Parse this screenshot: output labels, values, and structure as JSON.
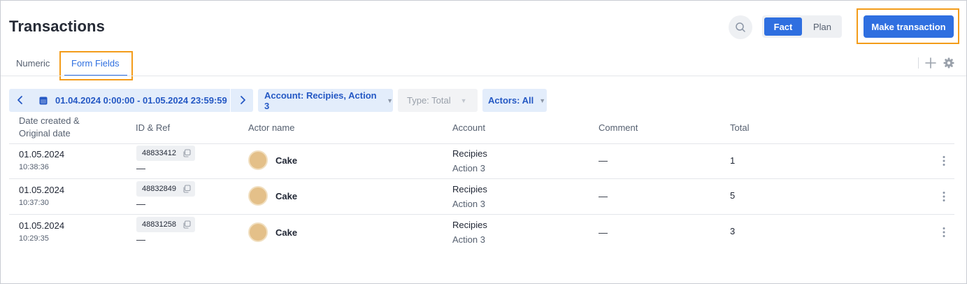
{
  "header": {
    "title": "Transactions",
    "toggle": {
      "fact": "Fact",
      "plan": "Plan"
    },
    "make_transaction": "Make transaction"
  },
  "tabs": [
    {
      "label": "Numeric",
      "active": false
    },
    {
      "label": "Form Fields",
      "active": true
    }
  ],
  "filters": {
    "date_range": "01.04.2024 0:00:00 - 01.05.2024 23:59:59",
    "account": "Account: Recipies, Action 3",
    "type": "Type: Total",
    "actors": "Actors: All"
  },
  "table": {
    "columns": {
      "date_line1": "Date created &",
      "date_line2": "Original date",
      "id_ref": "ID & Ref",
      "actor": "Actor name",
      "account": "Account",
      "comment": "Comment",
      "total": "Total"
    },
    "rows": [
      {
        "date": "01.05.2024",
        "time": "10:38:36",
        "id": "48833412",
        "ref": "—",
        "actor": "Cake",
        "account": "Recipies",
        "action": "Action 3",
        "comment": "—",
        "total": "1"
      },
      {
        "date": "01.05.2024",
        "time": "10:37:30",
        "id": "48832849",
        "ref": "—",
        "actor": "Cake",
        "account": "Recipies",
        "action": "Action 3",
        "comment": "—",
        "total": "5"
      },
      {
        "date": "01.05.2024",
        "time": "10:29:35",
        "id": "48831258",
        "ref": "—",
        "actor": "Cake",
        "account": "Recipies",
        "action": "Action 3",
        "comment": "—",
        "total": "3"
      }
    ]
  },
  "colors": {
    "accent": "#2f6fe0",
    "highlight_border": "#f39c1a",
    "filter_bg": "#e3edfb",
    "avatar": "#e4c089"
  },
  "icons": {
    "search": "search-icon",
    "prev": "chevron-left-icon",
    "next": "chevron-right-icon",
    "calendar": "calendar-icon",
    "add": "plus-icon",
    "settings": "gear-icon",
    "copy": "copy-icon",
    "row_menu": "more-vertical-icon"
  }
}
